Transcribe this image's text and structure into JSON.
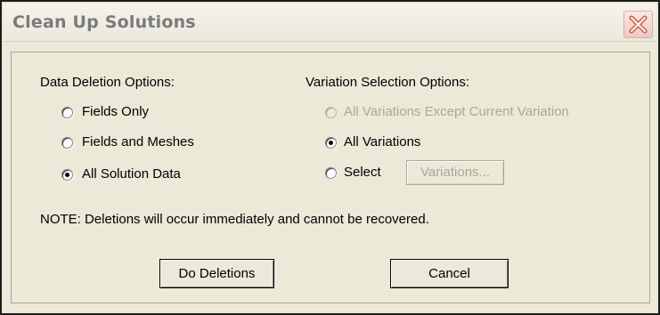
{
  "dialog": {
    "title": "Clean Up Solutions"
  },
  "data_deletion": {
    "heading": "Data Deletion Options:",
    "options": [
      {
        "label": "Fields Only",
        "selected": false
      },
      {
        "label": "Fields and Meshes",
        "selected": false
      },
      {
        "label": "All Solution Data",
        "selected": true
      }
    ]
  },
  "variation_selection": {
    "heading": "Variation Selection Options:",
    "options": [
      {
        "label": "All Variations Except Current Variation",
        "selected": false,
        "enabled": false
      },
      {
        "label": "All Variations",
        "selected": true,
        "enabled": true
      },
      {
        "label": "Select",
        "selected": false,
        "enabled": true
      }
    ],
    "variations_button_label": "Variations..."
  },
  "note": "NOTE: Deletions will occur immediately and cannot be recovered.",
  "buttons": {
    "do_deletions": "Do Deletions",
    "cancel": "Cancel"
  },
  "icons": {
    "close": "close-icon"
  }
}
